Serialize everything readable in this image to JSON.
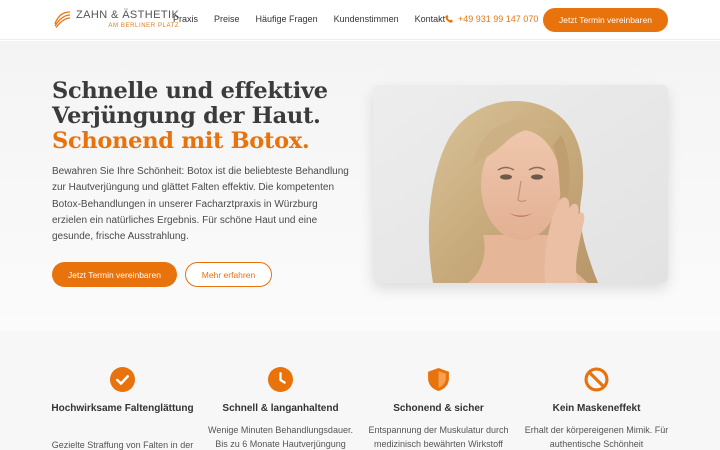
{
  "header": {
    "logo_name": "ZAHN & ÄSTHETIK",
    "logo_sub": "AM BERLINER PLATZ",
    "nav": [
      "Praxis",
      "Preise",
      "Häufige Fragen",
      "Kundenstimmen",
      "Kontakt"
    ],
    "phone": "+49 931 99 147 070",
    "cta": "Jetzt Termin vereinbaren"
  },
  "hero": {
    "title_line1": "Schnelle und effektive",
    "title_line2": "Verjüngung der Haut.",
    "title_accent": "Schonend mit Botox.",
    "text": "Bewahren Sie Ihre Schönheit: Botox ist die beliebteste Behandlung zur Hautverjüngung und glättet Falten effektiv. Die kompetenten Botox-Behandlungen in unserer Facharztpraxis in Würzburg erzielen ein natürliches Ergebnis. Für schöne Haut und eine gesunde, frische Ausstrahlung.",
    "primary_button": "Jetzt Termin vereinbaren",
    "secondary_button": "Mehr erfahren"
  },
  "features": [
    {
      "icon": "check-circle-icon",
      "title": "Hochwirksame Faltenglättung",
      "text": "Gezielte Straffung von Falten in der"
    },
    {
      "icon": "clock-icon",
      "title": "Schnell & langanhaltend",
      "text": "Wenige Minuten Behandlungsdauer. Bis zu 6 Monate Hautverjüngung"
    },
    {
      "icon": "shield-icon",
      "title": "Schonend & sicher",
      "text": "Entspannung der Muskulatur durch medizinisch bewährten Wirkstoff"
    },
    {
      "icon": "ban-icon",
      "title": "Kein Maskeneffekt",
      "text": "Erhalt der körpereigenen Mimik. Für authentische Schönheit"
    }
  ],
  "colors": {
    "accent": "#e8720c",
    "text": "#3b3b3b"
  }
}
